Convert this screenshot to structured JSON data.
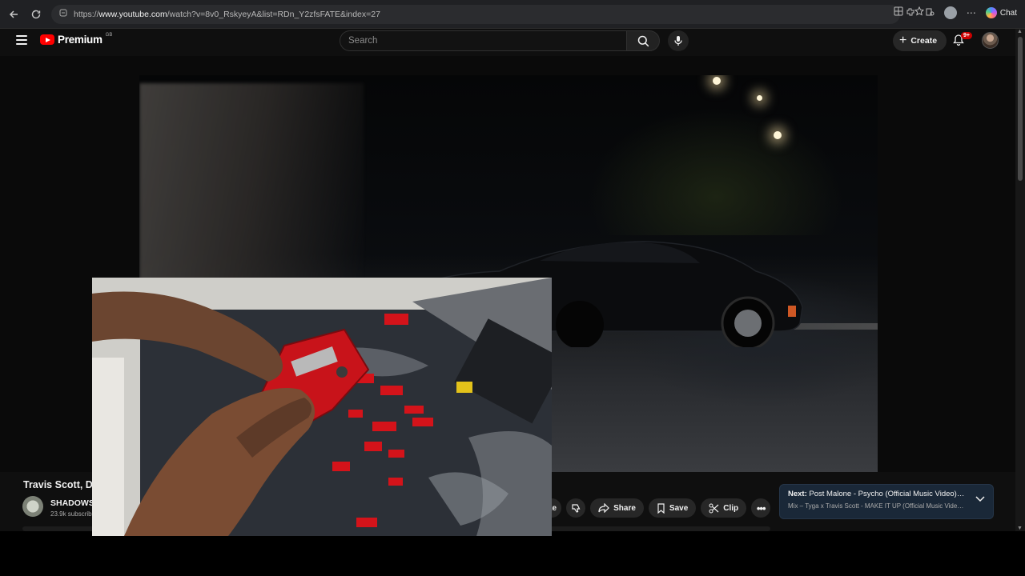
{
  "browser": {
    "url_prefix": "https://",
    "url_host": "www.youtube.com",
    "url_path": "/watch?v=8v0_RskyeyA&list=RDn_Y2zfsFATE&index=27",
    "chat_label": "Chat"
  },
  "header": {
    "logo_text": "Premium",
    "region": "GB",
    "search_placeholder": "Search",
    "create_label": "Create",
    "notification_count": "9+"
  },
  "video": {
    "title": "Travis Scott, D",
    "channel_name": "SHADOWS",
    "subscribers": "23.9k subscrib"
  },
  "actions": {
    "like_tail": "ke",
    "share_label": "Share",
    "save_label": "Save",
    "clip_label": "Clip"
  },
  "up_next": {
    "prefix": "Next:",
    "title": "Post Malone - Psycho (Official Music Video) f...",
    "subtitle": "Mix – Tyga x Travis Scott - MAKE IT UP (Official Music Video..."
  },
  "colors": {
    "yt_red": "#ff0000",
    "page_bg": "#0f0f0f",
    "next_card_bg": "#1a2838",
    "notif_badge": "#cc0000"
  }
}
